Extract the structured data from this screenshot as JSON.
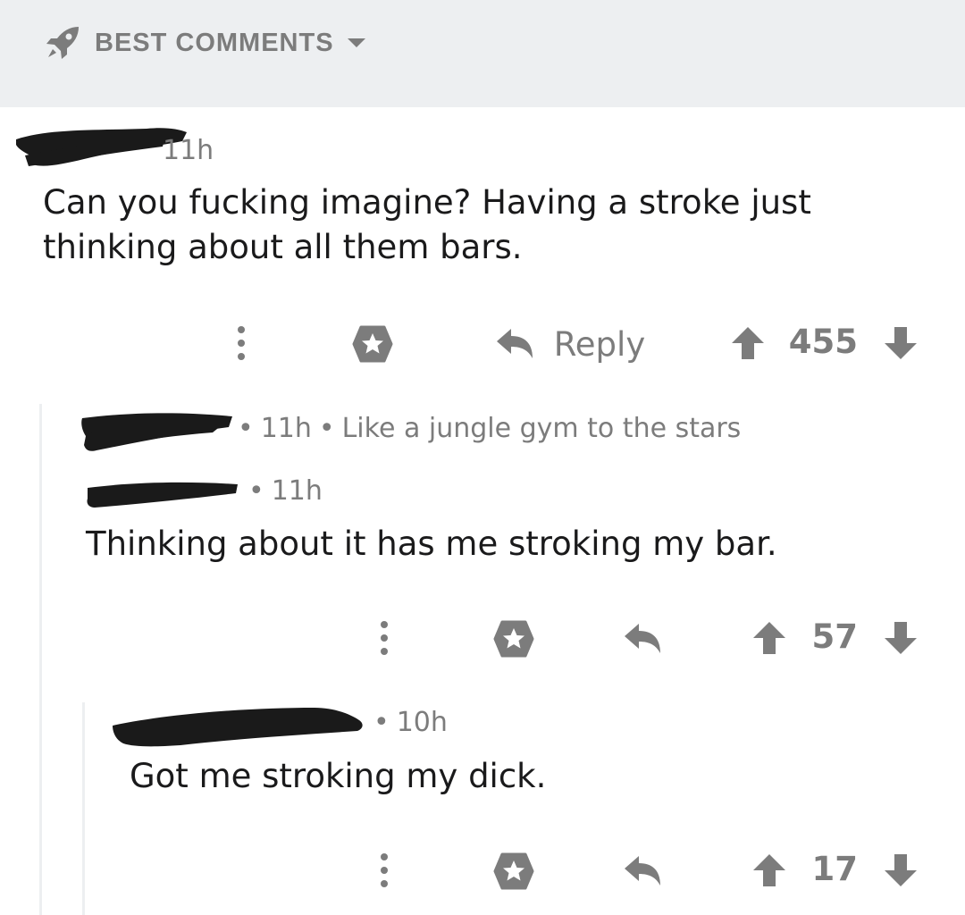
{
  "header": {
    "sort_label": "BEST COMMENTS",
    "icon": "rocket-icon"
  },
  "comments": [
    {
      "time": "11h",
      "flair": "",
      "body_lines": [
        "Can you fucking imagine? Having a stroke just",
        "thinking about all them bars."
      ],
      "reply_label": "Reply",
      "score": "455"
    },
    {
      "time": "11h",
      "flair": "Like a jungle gym to the stars"
    },
    {
      "time": "11h",
      "body": "Thinking about it has me stroking my bar.",
      "score": "57"
    },
    {
      "time": "10h",
      "body": "Got me stroking my dick.",
      "score": "17"
    }
  ],
  "colors": {
    "header_bg": "#edeff1",
    "meta": "#7c7c7c",
    "text": "#1a1a1b",
    "redaction": "#1a1a1a"
  }
}
